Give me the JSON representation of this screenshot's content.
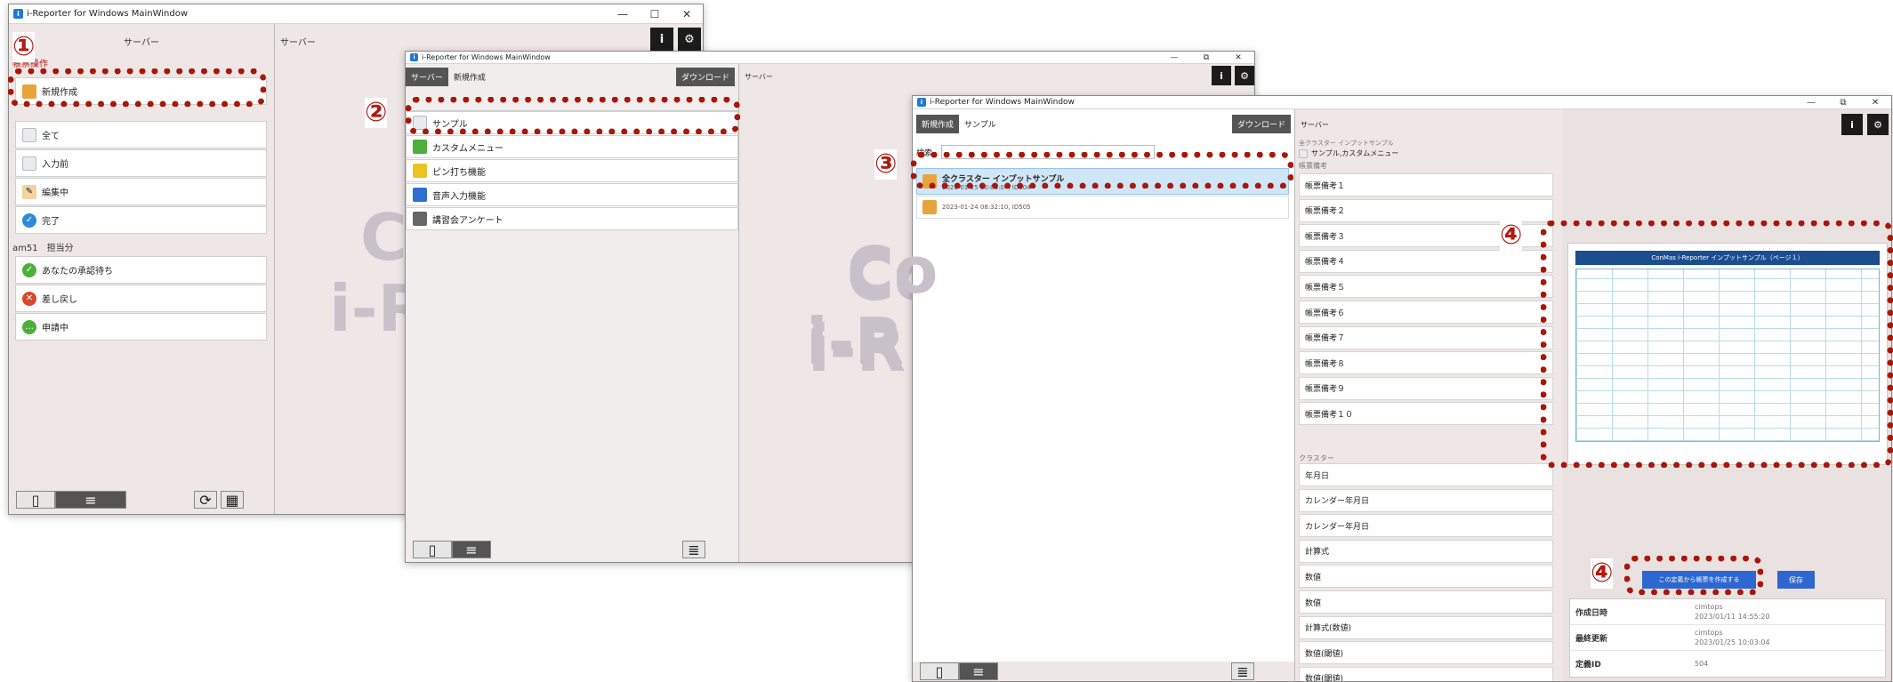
{
  "window1": {
    "title": "i-Reporter for Windows MainWindow",
    "left_header": "サーバー",
    "right_header": "サーバー",
    "section_label_top": "帳票操作",
    "new_item": "新規作成",
    "status_items": [
      "全て",
      "入力前",
      "編集中",
      "完了"
    ],
    "user_section_label": "am51　担当分",
    "user_items": [
      "あなたの承認待ち",
      "差し戻し",
      "申請中"
    ],
    "watermark_line1": "C",
    "watermark_line2": "i-R"
  },
  "window2": {
    "title": "i-Reporter for Windows MainWindow",
    "tab_server": "サーバー",
    "tab_new": "新規作成",
    "download_label": "ダウンロード",
    "right_header": "サーバー",
    "items": [
      "サンプル",
      "カスタムメニュー",
      "ピン打ち機能",
      "音声入力機能",
      "講習会アンケート"
    ],
    "watermark_line1": "Co",
    "watermark_line2": "i-R"
  },
  "window3": {
    "title": "i-Reporter for Windows MainWindow",
    "tab_new": "新規作成",
    "tab_sample": "サンプル",
    "download_label": "ダウンロード",
    "right_header": "サーバー",
    "search_label": "検索",
    "list_items": [
      {
        "title": "全クラスター インプットサンプル",
        "meta": "2023-01-25 10:03:04, ID504"
      },
      {
        "title": "",
        "meta": "2023-01-24 08:32:10, ID505"
      }
    ],
    "breadcrumb_top": "全クラスター インプットサンプル",
    "breadcrumb_path": "サンプル,カスタムメニュー",
    "remarks_label": "帳票備考",
    "remarks": [
      "帳票備考１",
      "帳票備考２",
      "帳票備考３",
      "帳票備考４",
      "帳票備考５",
      "帳票備考６",
      "帳票備考７",
      "帳票備考８",
      "帳票備考９",
      "帳票備考１０"
    ],
    "cluster_label": "クラスター",
    "clusters": [
      "年月日",
      "カレンダー年月日",
      "カレンダー年月日",
      "計算式",
      "数値",
      "数値",
      "計算式(数値)",
      "数値(閾値)",
      "数値(閾値)"
    ],
    "preview_title": "ConMas i-Reporter インプットサンプル（ページ１）",
    "create_button": "この定義から帳票を作成する",
    "save_button": "保存",
    "info": [
      {
        "key": "作成日時",
        "user": "cimtops",
        "value": "2023/01/11 14:55:20"
      },
      {
        "key": "最終更新",
        "user": "cimtops",
        "value": "2023/01/25 10:03:04"
      },
      {
        "key": "定義ID",
        "user": "",
        "value": "504"
      }
    ],
    "watermark_line1": "Co",
    "watermark_line2": "i-R"
  },
  "badges": [
    "①",
    "②",
    "③",
    "④",
    "④"
  ],
  "colors": {
    "accent_red": "#a8170a",
    "selection": "#cfe6f8",
    "primary_blue": "#2f67d0",
    "dark_tab": "#545454"
  }
}
